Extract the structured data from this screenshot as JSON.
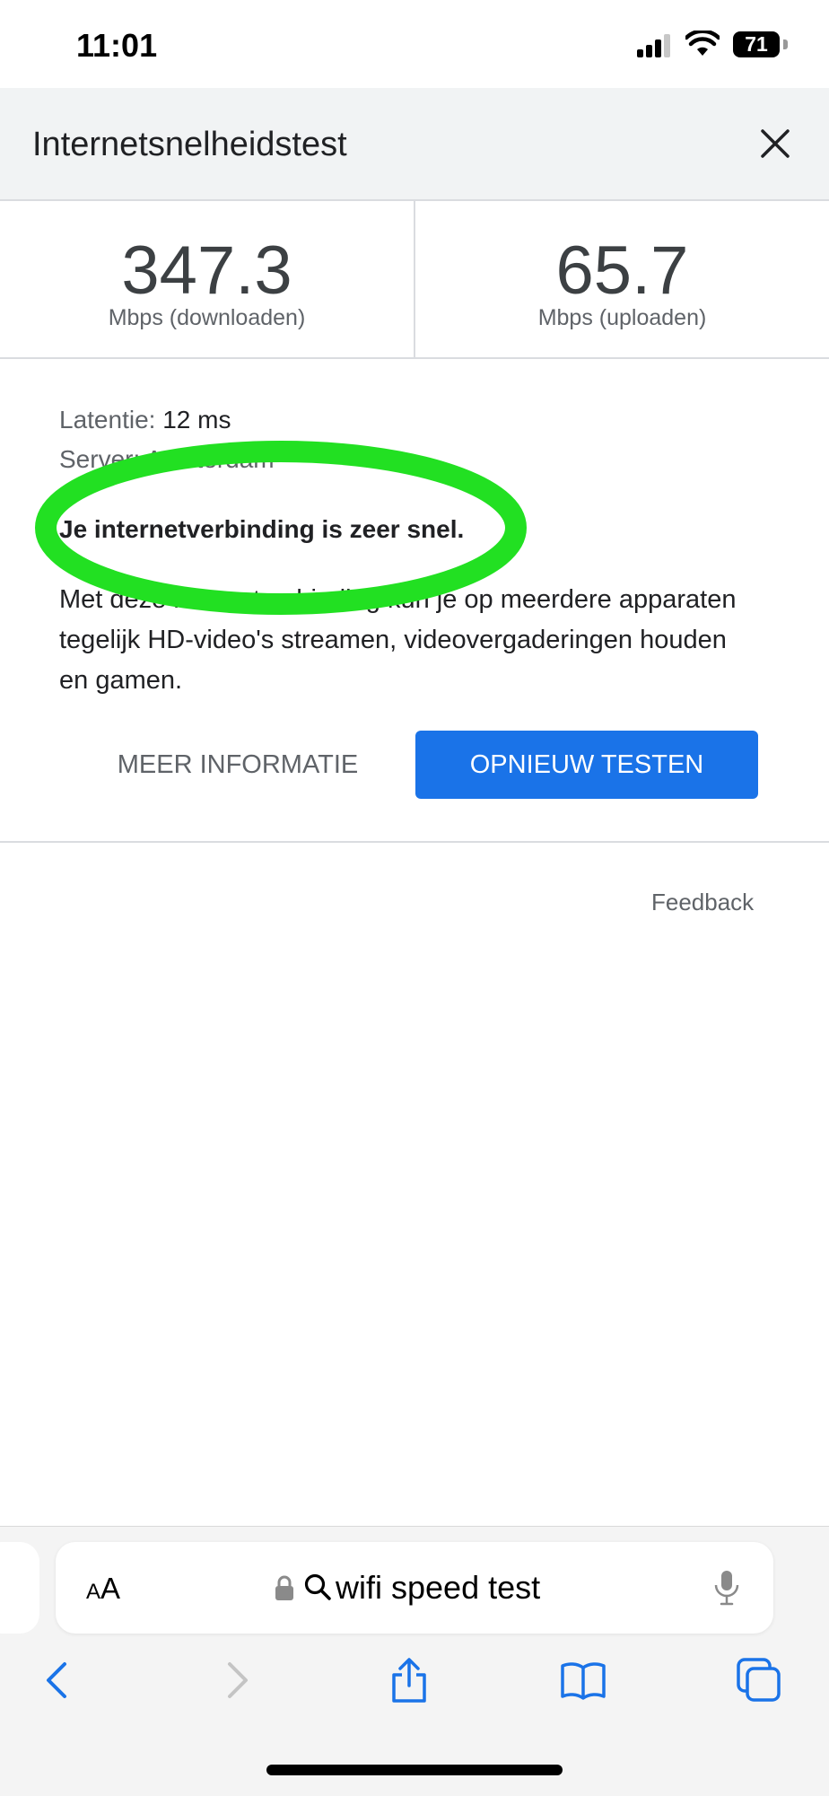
{
  "status_bar": {
    "time": "11:01",
    "battery": "71"
  },
  "header": {
    "title": "Internetsnelheidstest"
  },
  "results": {
    "download_value": "347.3",
    "download_unit": "Mbps (downloaden)",
    "upload_value": "65.7",
    "upload_unit": "Mbps (uploaden)",
    "latency_label": "Latentie:",
    "latency_value": "12 ms",
    "server_label": "Server:",
    "server_value": "Amsterdam",
    "verdict": "Je internetverbinding is zeer snel.",
    "description": "Met deze internetverbinding kun je op meerdere apparaten tegelijk HD-video's streamen, videovergaderingen houden en gamen."
  },
  "actions": {
    "more_info": "MEER INFORMATIE",
    "retest": "OPNIEUW TESTEN",
    "feedback": "Feedback"
  },
  "browser": {
    "aa_label_small": "A",
    "aa_label_large": "A",
    "url": "wifi speed test"
  },
  "colors": {
    "accent": "#1a73e8",
    "highlight": "#22e022"
  }
}
